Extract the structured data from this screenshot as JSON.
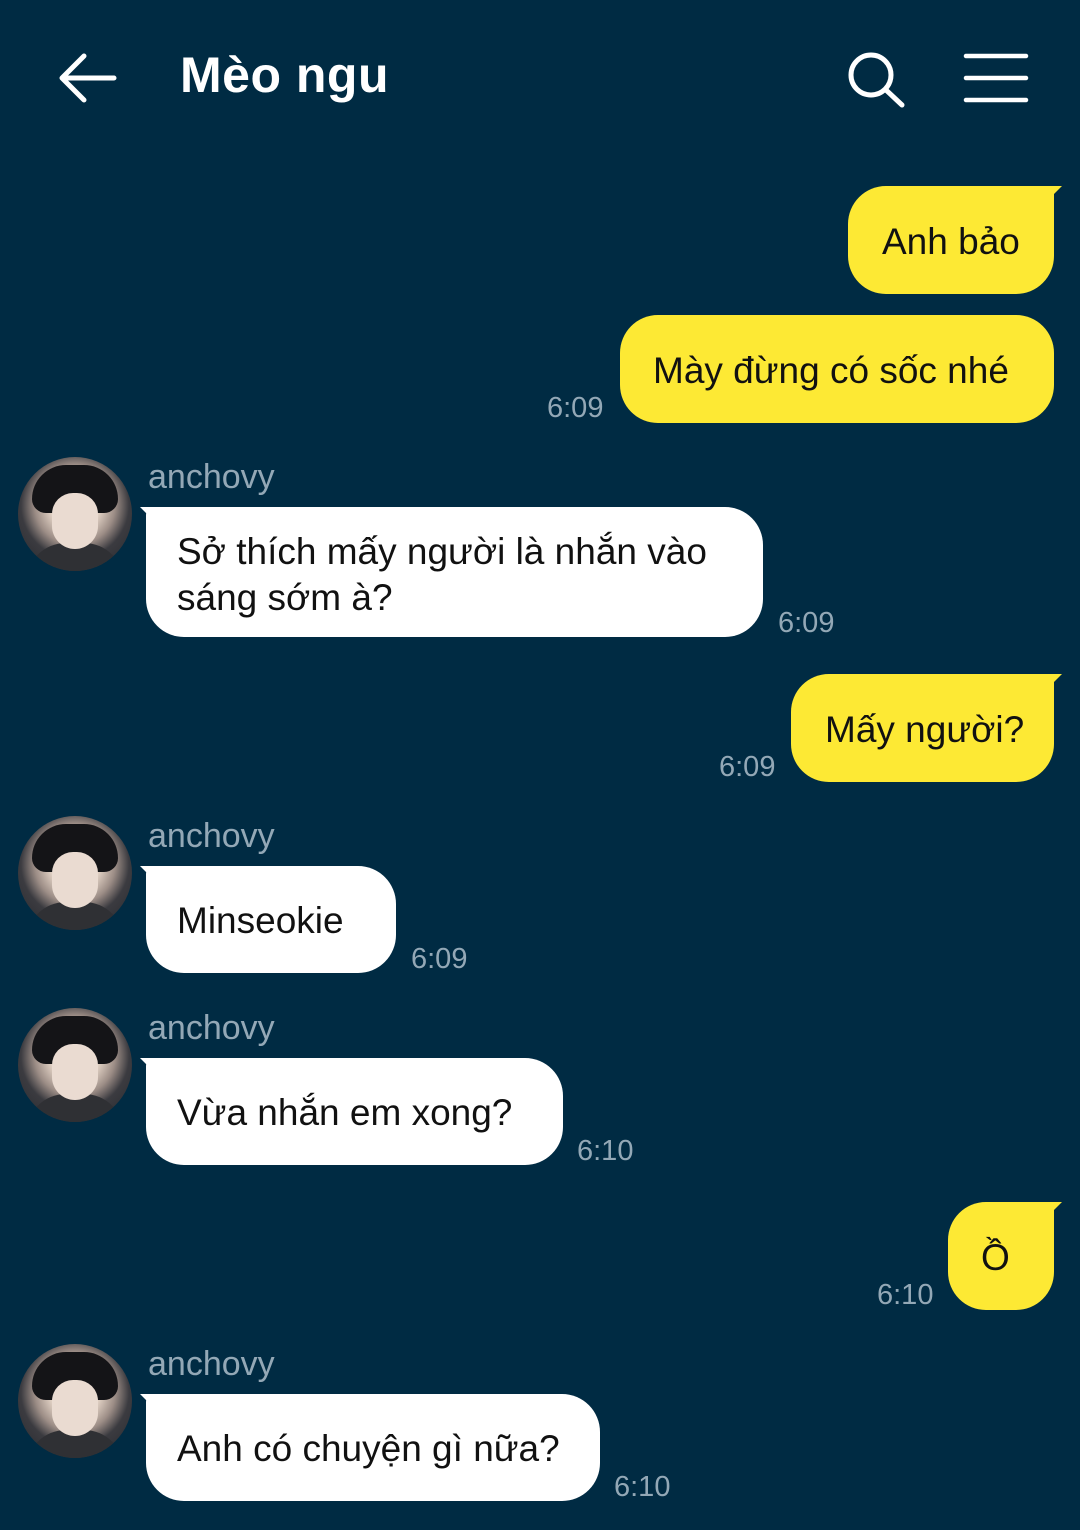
{
  "header": {
    "title": "Mèo ngu",
    "back_icon": "arrow-left-icon",
    "search_icon": "search-icon",
    "menu_icon": "hamburger-menu-icon"
  },
  "colors": {
    "background": "#002b43",
    "my_bubble": "#fde934",
    "their_bubble": "#ffffff",
    "meta_text": "#93a8b6"
  },
  "messages": [
    {
      "from": "me",
      "text": "Anh bảo",
      "time": ""
    },
    {
      "from": "me",
      "text": "Mày đừng có sốc nhé",
      "time": "6:09"
    },
    {
      "from": "them",
      "sender": "anchovy",
      "text_line1": "Sở thích mấy người là nhắn vào",
      "text_line2": "sáng sớm à?",
      "time": "6:09"
    },
    {
      "from": "me",
      "text": "Mấy người?",
      "time": "6:09"
    },
    {
      "from": "them",
      "sender": "anchovy",
      "text": "Minseokie",
      "time": "6:09"
    },
    {
      "from": "them",
      "sender": "anchovy",
      "text": "Vừa nhắn em xong?",
      "time": "6:10"
    },
    {
      "from": "me",
      "text": "Ồ",
      "time": "6:10"
    },
    {
      "from": "them",
      "sender": "anchovy",
      "text": "Anh có chuyện gì nữa?",
      "time": "6:10"
    }
  ]
}
